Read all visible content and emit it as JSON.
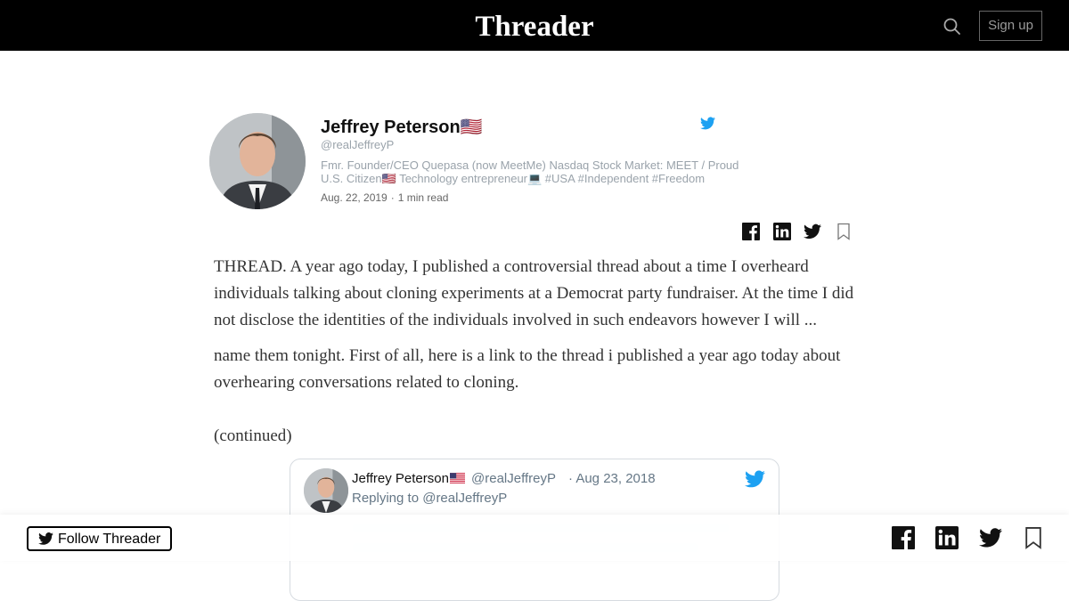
{
  "header": {
    "brand": "Threader",
    "signup_label": "Sign up"
  },
  "author": {
    "name": "Jeffrey Peterson🇺🇸",
    "handle": "@realJeffreyP",
    "bio_line1": "Fmr. Founder/CEO Quepasa (now MeetMe) Nasdaq Stock Market: MEET / Proud",
    "bio_line2": "U.S. Citizen🇺🇸 Technology entrepreneur💻 #USA #Independent #Freedom",
    "date": "Aug. 22, 2019",
    "separator": "·",
    "read_time": "1 min read"
  },
  "thread": {
    "paragraphs": [
      "THREAD. A year ago today, I published a controversial thread about a time I overheard individuals talking about cloning experiments at a Democrat party fundraiser. At the time I did not disclose the identities of the individuals involved in such endeavors however I will ...",
      "name them tonight. First of all, here is a link to the thread i published a year ago today about overhearing conversations related to cloning.",
      "(continued)"
    ]
  },
  "embedded_tweet": {
    "name": "Jeffrey Peterson",
    "handle": "@realJeffreyP",
    "date": "· Aug 23, 2018",
    "reply_text": "Replying to @realJeffreyP"
  },
  "footer": {
    "follow_label": "Follow Threader"
  },
  "icons": {
    "share": [
      "facebook-icon",
      "linkedin-icon",
      "twitter-icon",
      "bookmark-icon"
    ],
    "twitter_blue": "#1da1f2"
  }
}
